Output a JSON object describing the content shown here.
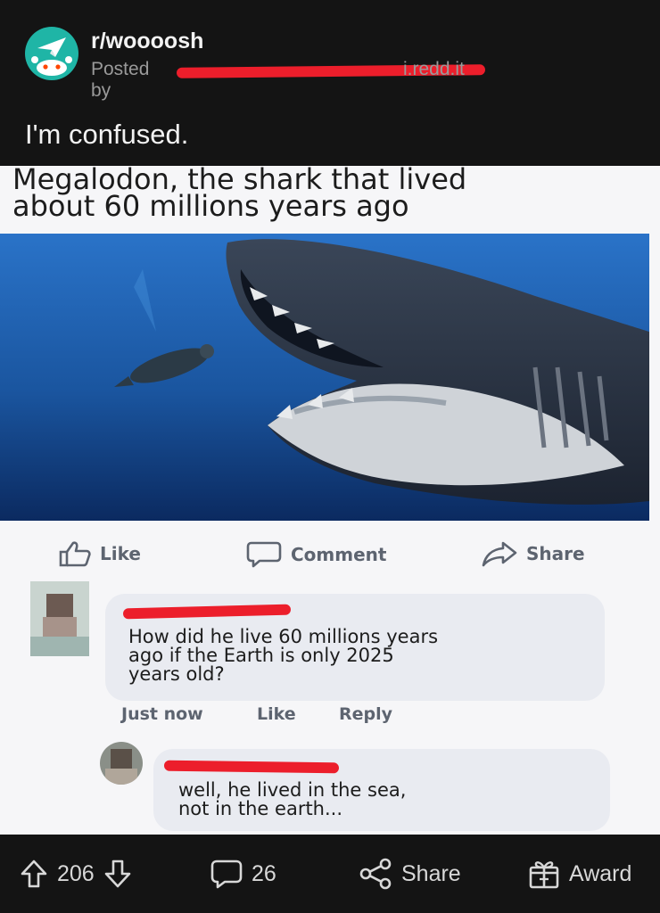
{
  "post": {
    "subreddit": "r/woooosh",
    "posted_by_prefix": "Posted by",
    "domain": "i.redd.it",
    "title": "I'm confused."
  },
  "meme": {
    "caption_line1": "Megalodon, the shark that lived",
    "caption_line2": "about 60 millions years ago",
    "actions": {
      "like": "Like",
      "comment": "Comment",
      "share": "Share"
    },
    "comments": [
      {
        "text_line1": "How did he live 60 millions years",
        "text_line2": "ago if the Earth is only 2025",
        "text_line3": "years old?",
        "time": "Just now",
        "like": "Like",
        "reply": "Reply"
      },
      {
        "text_line1": "well, he lived in the sea,",
        "text_line2": "not in the earth..."
      }
    ]
  },
  "footer": {
    "upvotes": "206",
    "comments": "26",
    "share": "Share",
    "award": "Award"
  },
  "colors": {
    "background": "#141414",
    "redaction": "#ec1e2b",
    "subreddit_avatar": "#1fb5a6"
  }
}
